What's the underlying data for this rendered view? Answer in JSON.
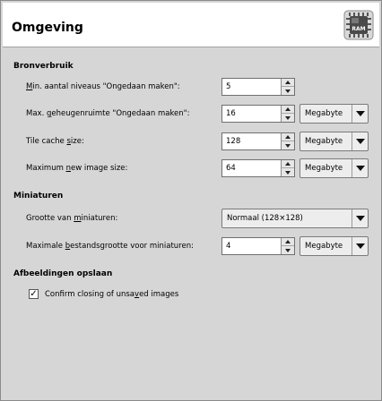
{
  "header": {
    "title": "Omgeving",
    "icon": "ram-chip-icon",
    "icon_text": "RAM"
  },
  "sections": {
    "resources": {
      "title": "Bronverbruik",
      "undo_levels": {
        "label_pre": "",
        "label_u": "M",
        "label_post": "in. aantal niveaus \"Ongedaan maken\":",
        "value": "5"
      },
      "undo_memory": {
        "label_pre": "Max. ",
        "label_u": "g",
        "label_post": "eheugenruimte \"Ongedaan maken\":",
        "value": "16",
        "unit": "Megabyte"
      },
      "tile_cache": {
        "label_pre": "Tile cache ",
        "label_u": "s",
        "label_post": "ize:",
        "value": "128",
        "unit": "Megabyte"
      },
      "max_image": {
        "label_pre": "Maximum ",
        "label_u": "n",
        "label_post": "ew image size:",
        "value": "64",
        "unit": "Megabyte"
      }
    },
    "thumbnails": {
      "title": "Miniaturen",
      "size": {
        "label_pre": "Grootte van ",
        "label_u": "m",
        "label_post": "iniaturen:",
        "value": "Normaal (128×128)"
      },
      "max_file": {
        "label_pre": "Maximale ",
        "label_u": "b",
        "label_post": "estandsgrootte voor miniaturen:",
        "value": "4",
        "unit": "Megabyte"
      }
    },
    "saving": {
      "title": "Afbeeldingen opslaan",
      "confirm": {
        "label_pre": "Confirm closing of unsa",
        "label_u": "v",
        "label_post": "ed images",
        "checked": "✓"
      }
    }
  },
  "colors": {
    "background": "#d6d6d6",
    "header_bg": "#ffffff"
  }
}
